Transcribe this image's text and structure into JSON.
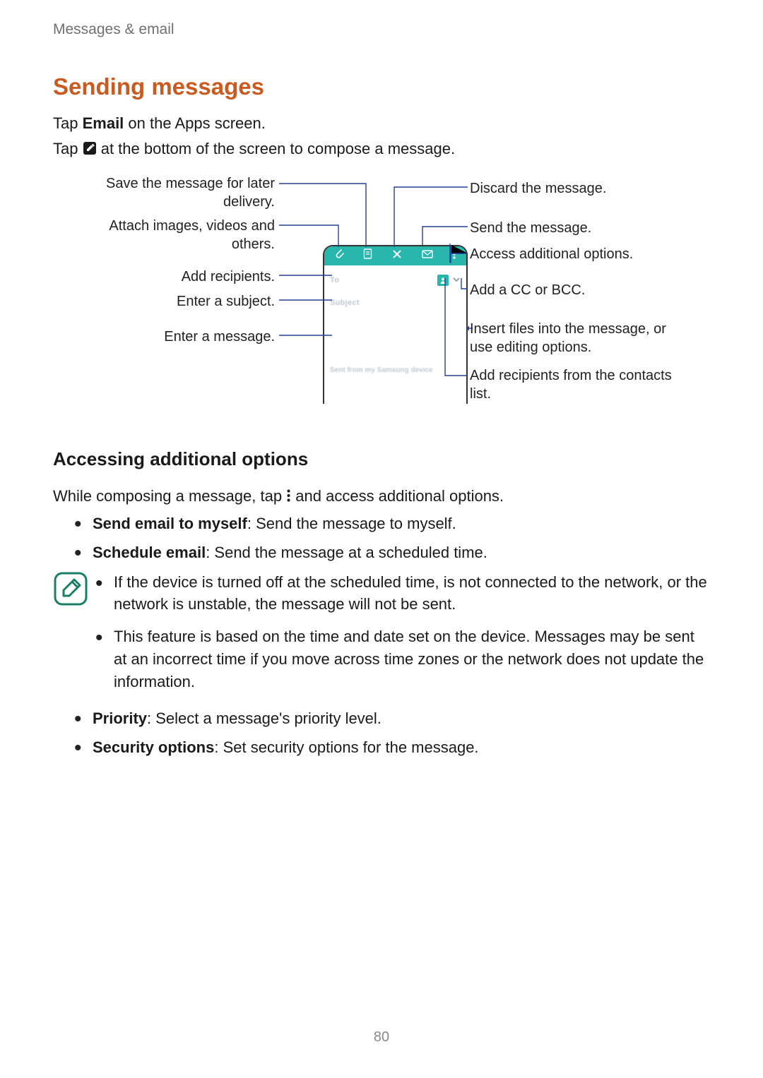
{
  "breadcrumb": "Messages & email",
  "h1": "Sending messages",
  "line1_a": "Tap ",
  "line1_bold": "Email",
  "line1_b": " on the Apps screen.",
  "line2_a": "Tap ",
  "line2_b": " at the bottom of the screen to compose a message.",
  "diagram": {
    "left": {
      "save": "Save the message for later delivery.",
      "attach": "Attach images, videos and others.",
      "recipients": "Add recipients.",
      "subject": "Enter a subject.",
      "message": "Enter a message."
    },
    "right": {
      "discard": "Discard the message.",
      "send": "Send the message.",
      "options": "Access additional options.",
      "ccbcc": "Add a CC or BCC.",
      "insert": "Insert files into the message, or use editing options.",
      "contacts": "Add recipients from the contacts list."
    },
    "phone": {
      "to": "To",
      "subject": "Subject",
      "signature": "Sent from my Samsung device"
    }
  },
  "h2": "Accessing additional options",
  "line3_a": "While composing a message, tap ",
  "line3_b": " and access additional options.",
  "bullets_main": [
    {
      "bold": "Send email to myself",
      "rest": ": Send the message to myself."
    },
    {
      "bold": "Schedule email",
      "rest": ": Send the message at a scheduled time."
    }
  ],
  "note_items": [
    "If the device is turned off at the scheduled time, is not connected to the network, or the network is unstable, the message will not be sent.",
    "This feature is based on the time and date set on the device. Messages may be sent at an incorrect time if you move across time zones or the network does not update the information."
  ],
  "bullets_tail": [
    {
      "bold": "Priority",
      "rest": ": Select a message's priority level."
    },
    {
      "bold": "Security options",
      "rest": ": Set security options for the message."
    }
  ],
  "page_number": "80"
}
